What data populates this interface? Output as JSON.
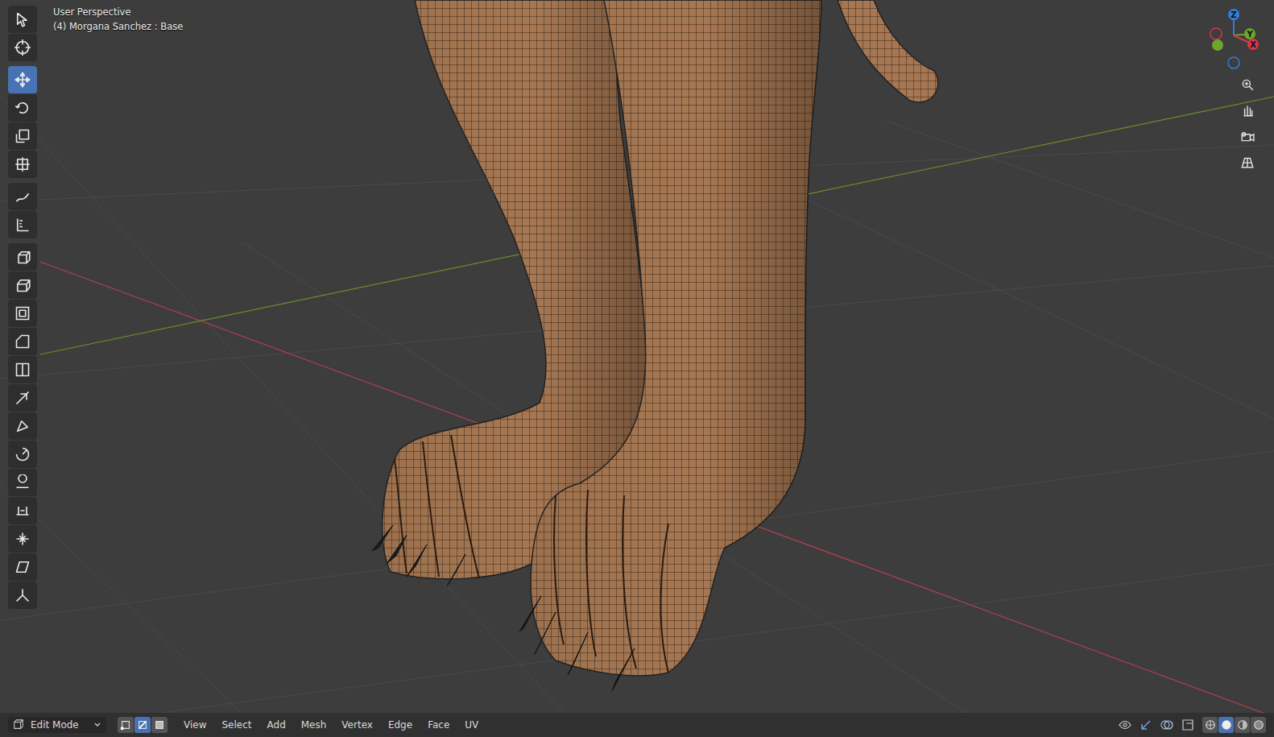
{
  "viewport": {
    "view_name": "User Perspective",
    "object_info": "(4) Morgana Sanchez : Base"
  },
  "toolbar": [
    {
      "kind": "select-box",
      "selected": false
    },
    {
      "kind": "cursor",
      "selected": false
    },
    {
      "kind": "move",
      "selected": true
    },
    {
      "kind": "rotate",
      "selected": false
    },
    {
      "kind": "scale",
      "selected": false
    },
    {
      "kind": "transform",
      "selected": false
    },
    {
      "kind": "annotate",
      "selected": false
    },
    {
      "kind": "measure",
      "selected": false
    },
    {
      "kind": "add-cube",
      "selected": false
    },
    {
      "kind": "extrude",
      "selected": false
    },
    {
      "kind": "inset",
      "selected": false
    },
    {
      "kind": "bevel",
      "selected": false
    },
    {
      "kind": "loop-cut",
      "selected": false
    },
    {
      "kind": "knife",
      "selected": false
    },
    {
      "kind": "poly-build",
      "selected": false
    },
    {
      "kind": "spin",
      "selected": false
    },
    {
      "kind": "smooth",
      "selected": false
    },
    {
      "kind": "edge-slide",
      "selected": false
    },
    {
      "kind": "shrink",
      "selected": false
    },
    {
      "kind": "shear",
      "selected": false
    },
    {
      "kind": "rip",
      "selected": false
    }
  ],
  "gizmo": {
    "axes": [
      {
        "label": "Z",
        "color": "#2f7fd8"
      },
      {
        "label": "Y",
        "color": "#6ea52a"
      },
      {
        "label": "X",
        "color": "#d4374b"
      }
    ]
  },
  "navigation": [
    {
      "kind": "zoom"
    },
    {
      "kind": "pan"
    },
    {
      "kind": "camera"
    },
    {
      "kind": "ortho"
    }
  ],
  "header": {
    "mode": "Edit Mode",
    "select_modes": [
      {
        "kind": "vertex",
        "selected": false
      },
      {
        "kind": "edge",
        "selected": true
      },
      {
        "kind": "face",
        "selected": false
      }
    ],
    "menus": [
      "View",
      "Select",
      "Add",
      "Mesh",
      "Vertex",
      "Edge",
      "Face",
      "UV"
    ],
    "shading": [
      {
        "kind": "wireframe",
        "selected": false
      },
      {
        "kind": "solid",
        "selected": true
      },
      {
        "kind": "material",
        "selected": false
      },
      {
        "kind": "rendered",
        "selected": false
      }
    ]
  }
}
